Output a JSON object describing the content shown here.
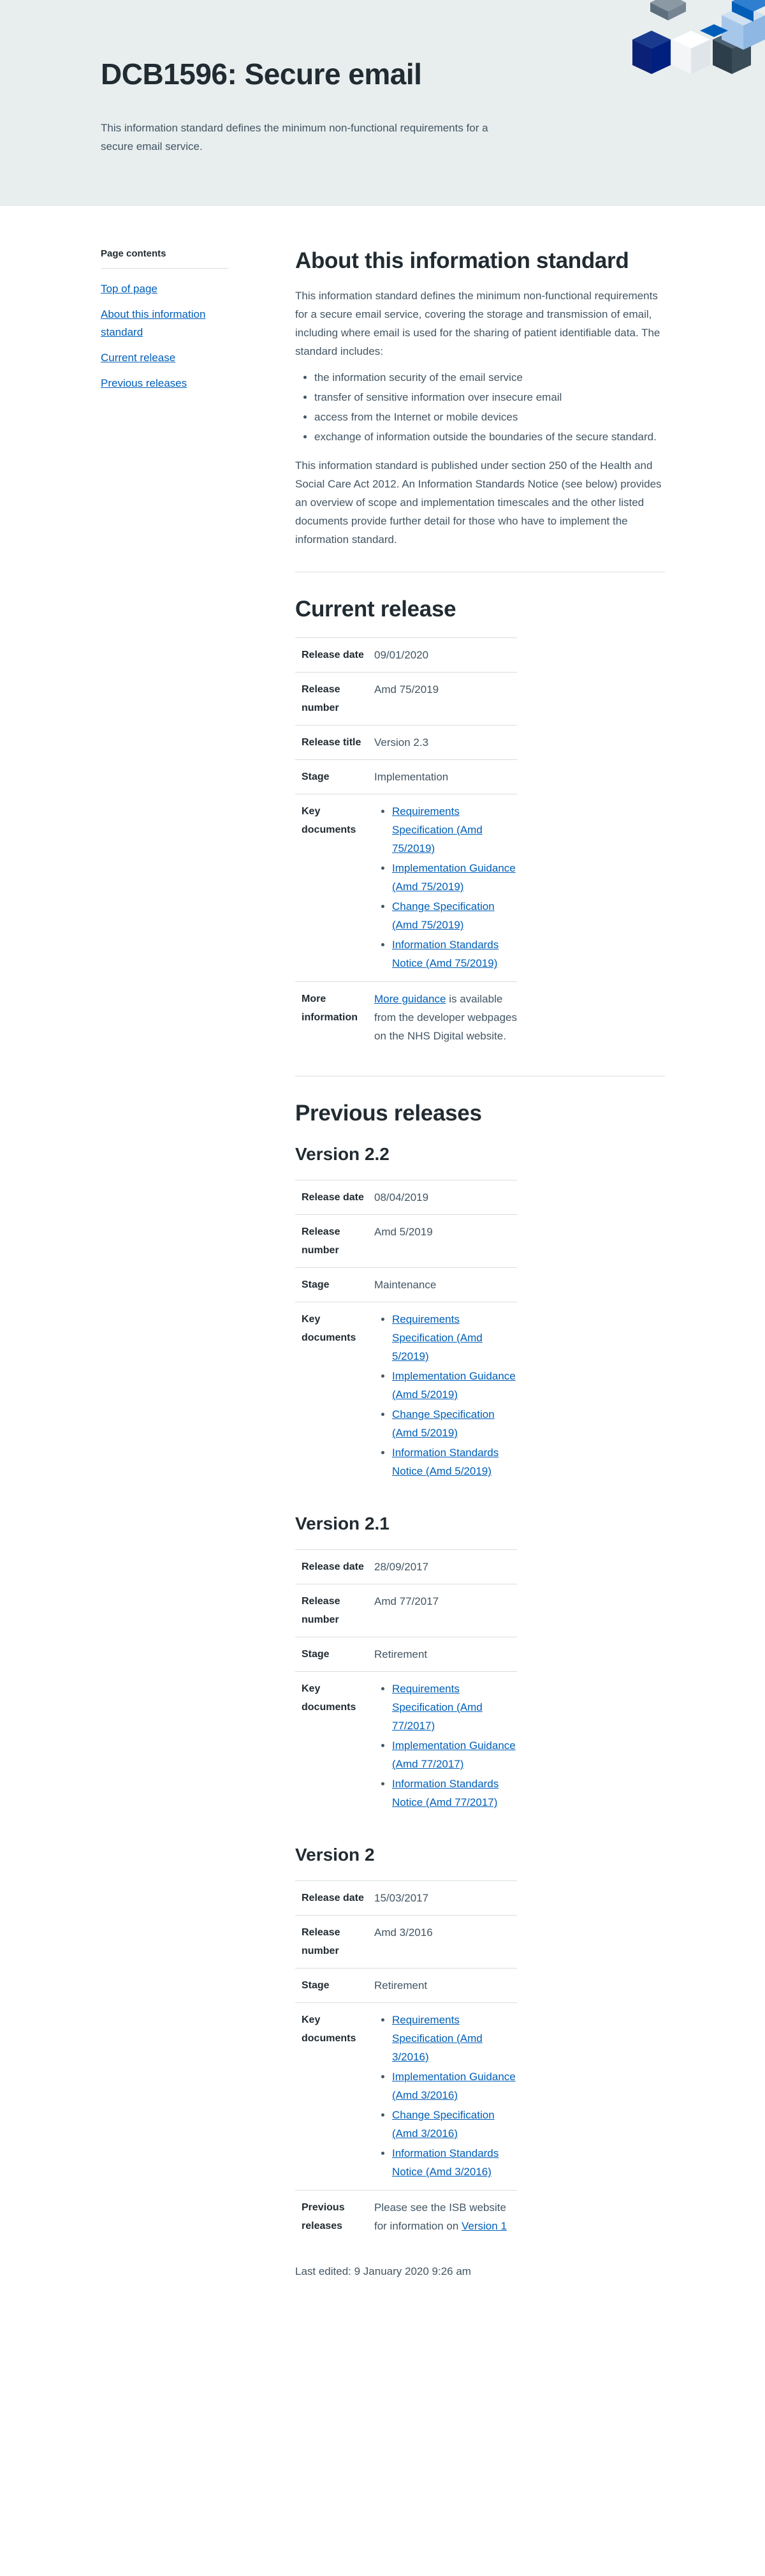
{
  "hero": {
    "title": "DCB1596: Secure email",
    "description": "This information standard defines the minimum non-functional requirements for a secure email service."
  },
  "sidebar": {
    "title": "Page contents",
    "items": [
      {
        "label": "Top of page"
      },
      {
        "label": "About this information standard"
      },
      {
        "label": "Current release"
      },
      {
        "label": "Previous releases"
      }
    ]
  },
  "about": {
    "heading": "About this information standard",
    "intro": "This information standard defines the minimum non-functional requirements for a secure email service, covering the storage and transmission of email, including where email is used for the sharing of patient identifiable data. The standard includes:",
    "bullets": [
      "the information security of the email service",
      "transfer of sensitive information over insecure email",
      "access from the Internet or mobile devices",
      "exchange of information outside the boundaries of the secure standard."
    ],
    "outro": "This information standard is published under section 250 of the Health and Social Care Act 2012. An Information Standards Notice (see below) provides an overview of scope and implementation timescales and the other listed documents provide further detail for those who have to implement the information standard."
  },
  "labels": {
    "release_date": "Release date",
    "release_number": "Release number",
    "release_title": "Release title",
    "stage": "Stage",
    "key_documents": "Key documents",
    "more_information": "More information",
    "previous_releases": "Previous releases"
  },
  "current": {
    "heading": "Current release",
    "release_date": "09/01/2020",
    "release_number": "Amd 75/2019",
    "release_title": "Version 2.3",
    "stage": "Implementation",
    "documents": [
      "Requirements Specification (Amd 75/2019)",
      "Implementation Guidance (Amd 75/2019)",
      "Change Specification (Amd 75/2019)",
      "Information Standards Notice (Amd 75/2019)"
    ],
    "more_info_link": "More guidance",
    "more_info_text": " is available from the developer webpages on the NHS Digital website."
  },
  "previous": {
    "heading": "Previous releases",
    "versions": [
      {
        "title": "Version 2.2",
        "release_date": "08/04/2019",
        "release_number": "Amd 5/2019",
        "stage": "Maintenance",
        "documents": [
          "Requirements Specification (Amd 5/2019)",
          "Implementation Guidance (Amd 5/2019)",
          "Change Specification (Amd 5/2019)",
          "Information Standards Notice (Amd 5/2019)"
        ]
      },
      {
        "title": "Version 2.1",
        "release_date": "28/09/2017",
        "release_number": "Amd 77/2017",
        "stage": "Retirement",
        "documents": [
          "Requirements Specification (Amd 77/2017)",
          "Implementation Guidance (Amd 77/2017)",
          "Information Standards Notice (Amd 77/2017)"
        ]
      },
      {
        "title": "Version 2",
        "release_date": "15/03/2017",
        "release_number": "Amd 3/2016",
        "stage": "Retirement",
        "documents": [
          "Requirements Specification (Amd 3/2016)",
          "Implementation Guidance (Amd 3/2016)",
          "Change Specification (Amd 3/2016)",
          "Information Standards Notice (Amd 3/2016)"
        ],
        "previous_text": "Please see the ISB website for information on ",
        "previous_link": "Version 1"
      }
    ]
  },
  "footer": {
    "last_edited": "Last edited: 9 January 2020 9:26 am"
  },
  "colors": {
    "link": "#005eb8",
    "hero_bg": "#e8edee",
    "text": "#425563",
    "heading": "#212b32"
  }
}
